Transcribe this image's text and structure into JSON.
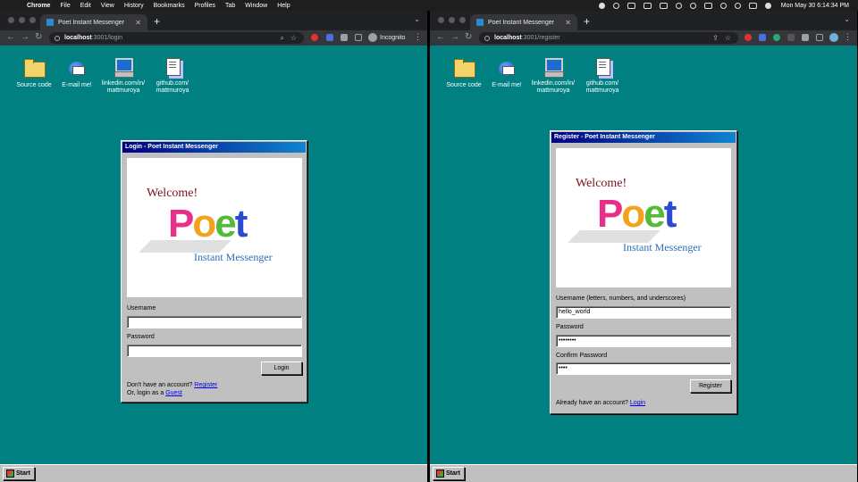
{
  "menubar": {
    "app": "Chrome",
    "items": [
      "File",
      "Edit",
      "View",
      "History",
      "Bookmarks",
      "Profiles",
      "Tab",
      "Window",
      "Help"
    ],
    "clock": "Mon May 30  6:14:34 PM"
  },
  "left_window": {
    "tab_title": "Poet Instant Messenger",
    "url_host": "localhost",
    "url_path": ":3001/login",
    "incognito_label": "Incognito"
  },
  "right_window": {
    "tab_title": "Poet Instant Messenger",
    "url_host": "localhost",
    "url_path": ":3001/register"
  },
  "desktop_icons": [
    {
      "label": "Source code",
      "icon": "folder-icon"
    },
    {
      "label": "E-mail me!",
      "icon": "email-globe-icon"
    },
    {
      "label": "linkedin.com/in/ mattmuroya",
      "icon": "computer-icon"
    },
    {
      "label": "github.com/ mattmuroya",
      "icon": "document-icon"
    }
  ],
  "login": {
    "title": "Login - Poet Instant Messenger",
    "logo": {
      "welcome": "Welcome!",
      "poet": "Poet",
      "subtitle": "Instant Messenger"
    },
    "username_label": "Username",
    "username_value": "",
    "password_label": "Password",
    "password_value": "",
    "login_button": "Login",
    "no_account_text": "Don't have an account?",
    "register_link": "Register",
    "guest_text": "Or, login as a",
    "guest_link": "Guest"
  },
  "register": {
    "title": "Register - Poet Instant Messenger",
    "logo": {
      "welcome": "Welcome!",
      "poet": "Poet",
      "subtitle": "Instant Messenger"
    },
    "username_label": "Username (letters, numbers, and underscores)",
    "username_value": "hello_world",
    "password_label": "Password",
    "password_value": "••••••••",
    "confirm_label": "Confirm Password",
    "confirm_value": "••••",
    "register_button": "Register",
    "have_account_text": "Already have an account?",
    "login_link": "Login"
  },
  "taskbar": {
    "start_label": "Start"
  }
}
